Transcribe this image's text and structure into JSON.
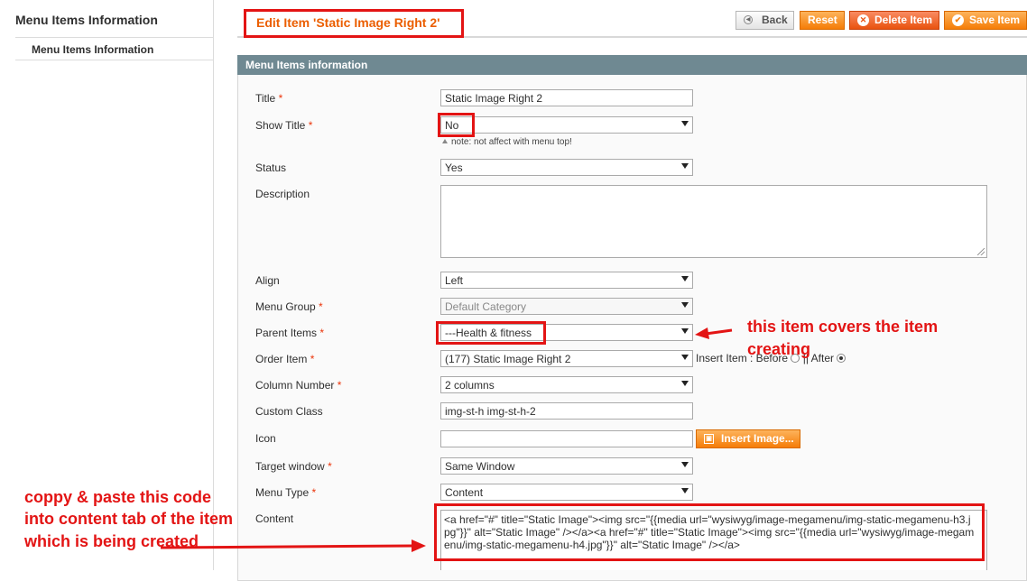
{
  "sidebar": {
    "title": "Menu Items Information",
    "items": [
      {
        "label": "Menu Items Information"
      }
    ]
  },
  "header": {
    "title": "Edit Item 'Static Image Right 2'",
    "buttons": {
      "back": "Back",
      "reset": "Reset",
      "delete": "Delete Item",
      "save": "Save Item"
    }
  },
  "section": {
    "title": "Menu Items information"
  },
  "required_mark": "*",
  "form": {
    "title": {
      "label": "Title",
      "value": "Static Image Right 2"
    },
    "show_title": {
      "label": "Show Title",
      "value": "No",
      "note": "note: not affect with menu top!"
    },
    "status": {
      "label": "Status",
      "value": "Yes"
    },
    "description": {
      "label": "Description",
      "value": ""
    },
    "align": {
      "label": "Align",
      "value": "Left"
    },
    "menu_group": {
      "label": "Menu Group",
      "value": "Default Category"
    },
    "parent_items": {
      "label": "Parent Items",
      "value": "---Health & fitness"
    },
    "order_item": {
      "label": "Order Item",
      "value": "(177) Static Image Right 2",
      "insert_label": "Insert Item : Before",
      "separator": "||",
      "after_label": "After",
      "selected": "After"
    },
    "column_number": {
      "label": "Column Number",
      "value": "2 columns"
    },
    "custom_class": {
      "label": "Custom Class",
      "value": "img-st-h img-st-h-2"
    },
    "icon": {
      "label": "Icon",
      "value": "",
      "insert_button": "Insert Image..."
    },
    "target_window": {
      "label": "Target window",
      "value": "Same Window"
    },
    "menu_type": {
      "label": "Menu Type",
      "value": "Content"
    },
    "content": {
      "label": "Content",
      "value": "<a href=\"#\" title=\"Static Image\"><img src=\"{{media url=\"wysiwyg/image-megamenu/img-static-megamenu-h3.jpg\"}}\" alt=\"Static Image\" /></a><a href=\"#\" title=\"Static Image\"><img src=\"{{media url=\"wysiwyg/image-megamenu/img-static-megamenu-h4.jpg\"}}\" alt=\"Static Image\" /></a>"
    }
  },
  "annotations": {
    "parent_note_line1": "this item covers the item",
    "parent_note_line2": "creating",
    "content_note_line1": "coppy & paste this code",
    "content_note_line2": "into content tab of the item",
    "content_note_line3": "which is being created"
  },
  "colors": {
    "accent_orange": "#f57d08",
    "title_orange": "#eb5e00",
    "annotation_red": "#e31414",
    "section_bar": "#6f8992"
  }
}
